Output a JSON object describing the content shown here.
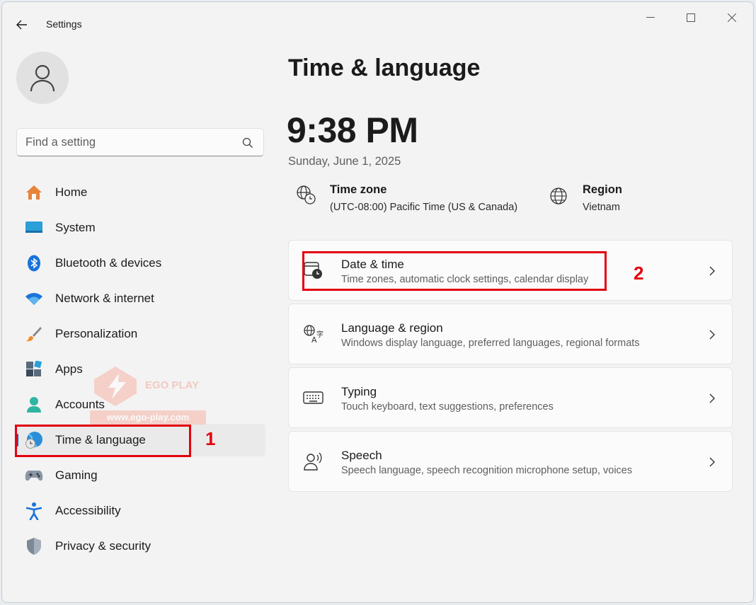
{
  "window": {
    "title": "Settings"
  },
  "search": {
    "placeholder": "Find a setting"
  },
  "sidebar": {
    "items": [
      {
        "label": "Home",
        "icon": "home-icon"
      },
      {
        "label": "System",
        "icon": "system-icon"
      },
      {
        "label": "Bluetooth & devices",
        "icon": "bluetooth-icon"
      },
      {
        "label": "Network & internet",
        "icon": "wifi-icon"
      },
      {
        "label": "Personalization",
        "icon": "brush-icon"
      },
      {
        "label": "Apps",
        "icon": "apps-icon"
      },
      {
        "label": "Accounts",
        "icon": "accounts-icon"
      },
      {
        "label": "Time & language",
        "icon": "time-language-icon",
        "active": true
      },
      {
        "label": "Gaming",
        "icon": "gamepad-icon"
      },
      {
        "label": "Accessibility",
        "icon": "accessibility-icon"
      },
      {
        "label": "Privacy & security",
        "icon": "shield-icon"
      }
    ]
  },
  "main": {
    "title": "Time & language",
    "clock": "9:38 PM",
    "date": "Sunday, June 1, 2025",
    "time_zone": {
      "title": "Time zone",
      "value": "(UTC-08:00) Pacific Time (US & Canada)"
    },
    "region": {
      "title": "Region",
      "value": "Vietnam"
    },
    "cards": [
      {
        "title": "Date & time",
        "subtitle": "Time zones, automatic clock settings, calendar display",
        "icon": "calendar-clock-icon"
      },
      {
        "title": "Language & region",
        "subtitle": "Windows display language, preferred languages, regional formats",
        "icon": "language-icon"
      },
      {
        "title": "Typing",
        "subtitle": "Touch keyboard, text suggestions, preferences",
        "icon": "keyboard-icon"
      },
      {
        "title": "Speech",
        "subtitle": "Speech language, speech recognition microphone setup, voices",
        "icon": "speech-icon"
      }
    ]
  },
  "annotations": {
    "step1": "1",
    "step2": "2"
  },
  "watermark": {
    "brand": "EGO PLAY",
    "url": "www.ego-play.com"
  },
  "colors": {
    "accent": "#0067c0",
    "annotation": "#e3000f",
    "background": "#f3f3f3",
    "card": "#fbfbfb"
  }
}
